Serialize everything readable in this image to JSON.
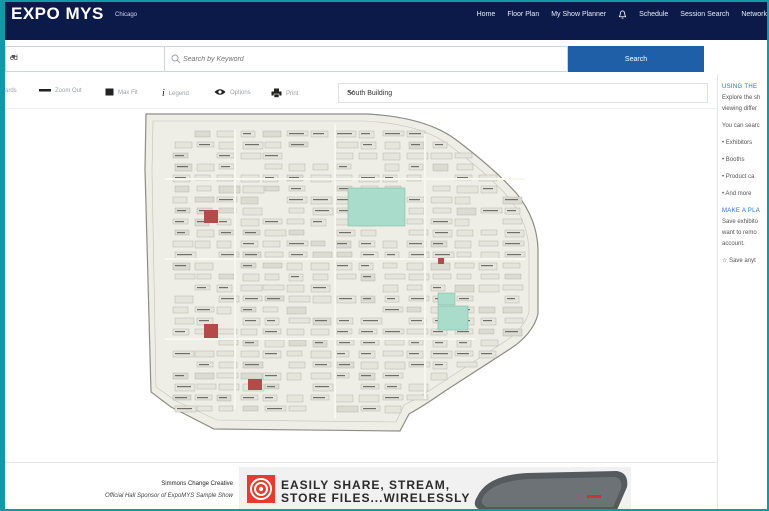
{
  "header": {
    "logo": "EXPO MYS",
    "city": "Chicago",
    "nav": [
      "Home",
      "Floor Plan",
      "My Show Planner",
      "Schedule",
      "Session Search",
      "Network"
    ]
  },
  "search": {
    "dropdown_value": "ed",
    "placeholder": "Search by Keyword",
    "button_label": "Search"
  },
  "toolbar": {
    "items": [
      "ards",
      "Zoom Out",
      "Max Fit",
      "Legend",
      "Options",
      "Print"
    ],
    "building": "South Building"
  },
  "right_panel": {
    "heading1": "USING THE",
    "intro1": "Explore the sh",
    "intro2": "viewing differ",
    "search_intro": "You can searc",
    "bullets": [
      "• Exhibitors",
      "• Booths",
      "• Product ca",
      "• And more"
    ],
    "heading2": "MAKE A PLA",
    "save1": "Save exhibito",
    "save2": "want to remo",
    "save3": "account.",
    "save_link": "Save anyt"
  },
  "footer": {
    "sponsor_name": "Simmons Change Creative",
    "sponsor_line": "Official Hall Sponsor of ExpoMYS Sample Show",
    "ad_line1": "EASILY SHARE, STREAM,",
    "ad_line2": "STORE FILES...WIRELESSLY"
  },
  "colors": {
    "header_bg": "#0c1a4a",
    "search_button": "#1f5fa8",
    "frame_border": "#0f9aa6",
    "map_fill": "#efeee6",
    "highlight_booth": "#a9dccb"
  }
}
